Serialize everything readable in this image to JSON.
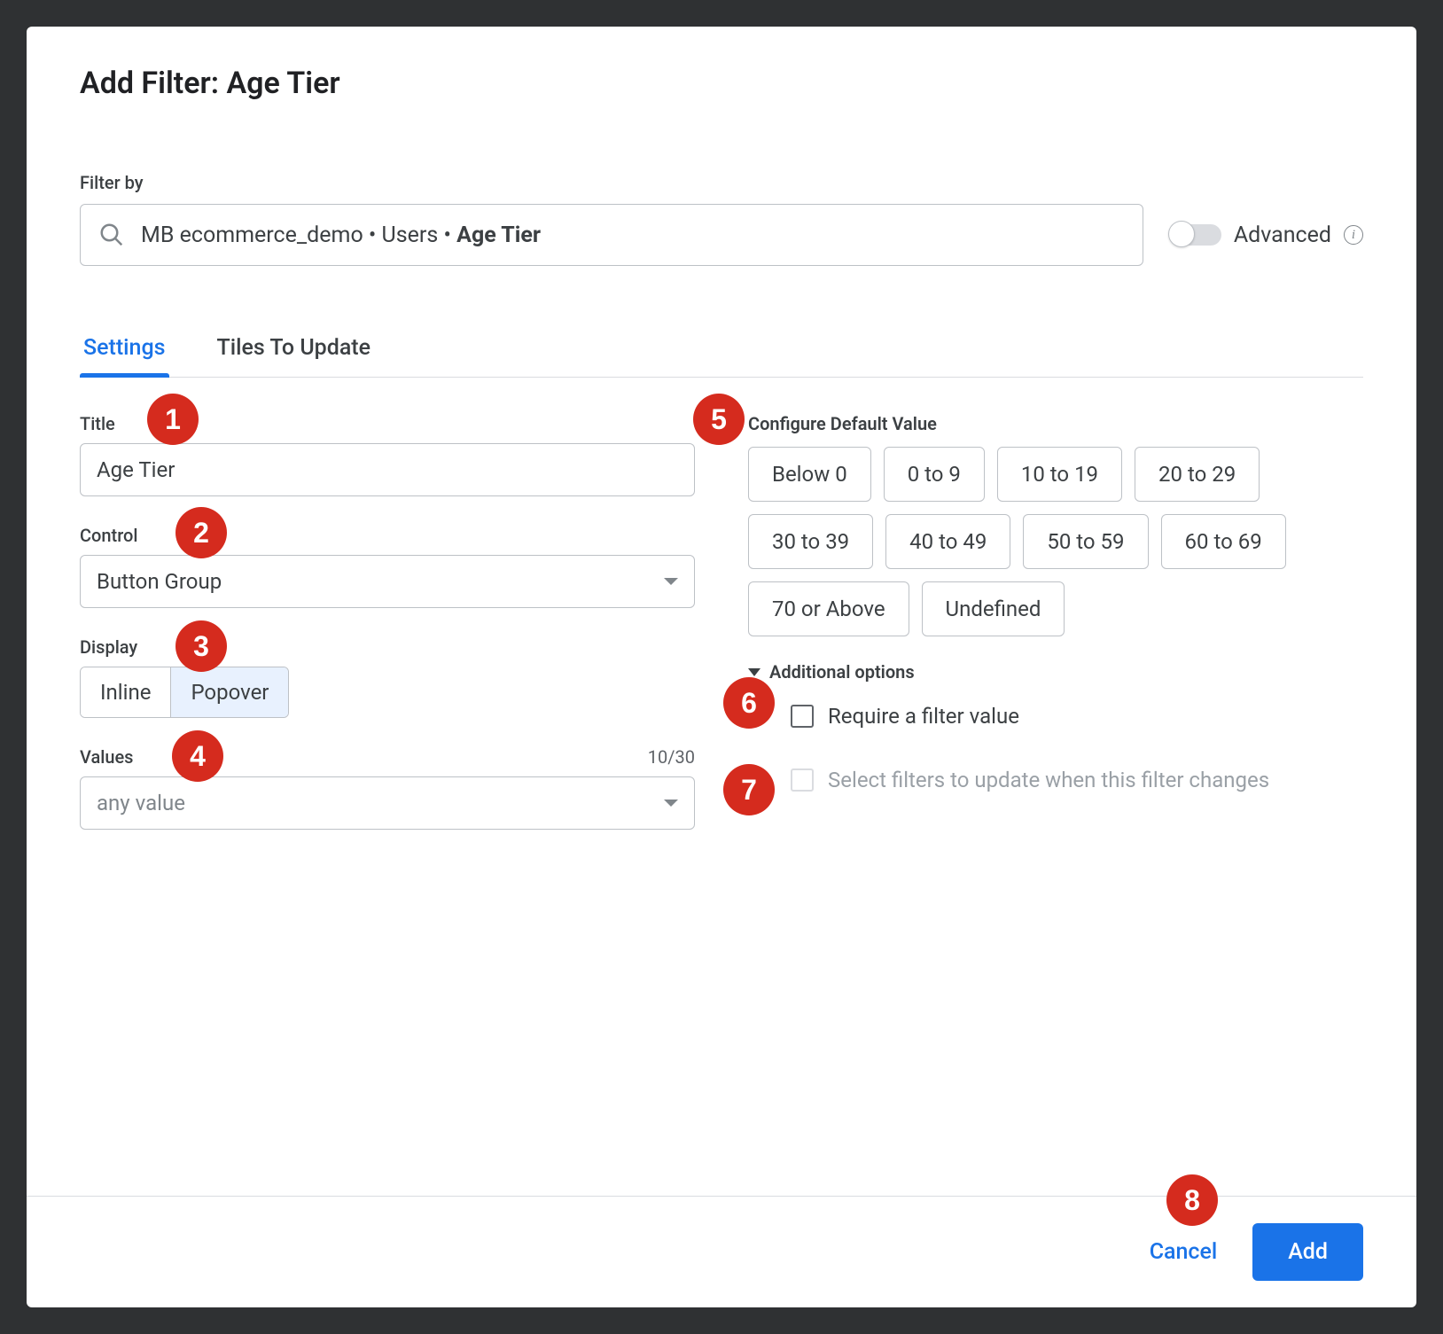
{
  "dialog": {
    "title": "Add Filter: Age Tier"
  },
  "filterBy": {
    "label": "Filter by",
    "prefix": "MB ecommerce_demo • Users • ",
    "bold": "Age Tier"
  },
  "advanced": {
    "label": "Advanced"
  },
  "tabs": {
    "settings": "Settings",
    "tilesToUpdate": "Tiles To Update"
  },
  "settings": {
    "title": {
      "label": "Title",
      "value": "Age Tier"
    },
    "control": {
      "label": "Control",
      "value": "Button Group"
    },
    "display": {
      "label": "Display",
      "inline": "Inline",
      "popover": "Popover"
    },
    "values": {
      "label": "Values",
      "counter": "10/30",
      "value": "any value"
    }
  },
  "config": {
    "label": "Configure Default Value",
    "options": [
      "Below 0",
      "0 to 9",
      "10 to 19",
      "20 to 29",
      "30 to 39",
      "40 to 49",
      "50 to 59",
      "60 to 69",
      "70 or Above",
      "Undefined"
    ],
    "additionalHeader": "Additional options",
    "requireLabel": "Require a filter value",
    "selectFiltersLabel": "Select filters to update when this filter changes"
  },
  "footer": {
    "cancel": "Cancel",
    "add": "Add"
  },
  "callouts": {
    "c1": "1",
    "c2": "2",
    "c3": "3",
    "c4": "4",
    "c5": "5",
    "c6": "6",
    "c7": "7",
    "c8": "8"
  }
}
